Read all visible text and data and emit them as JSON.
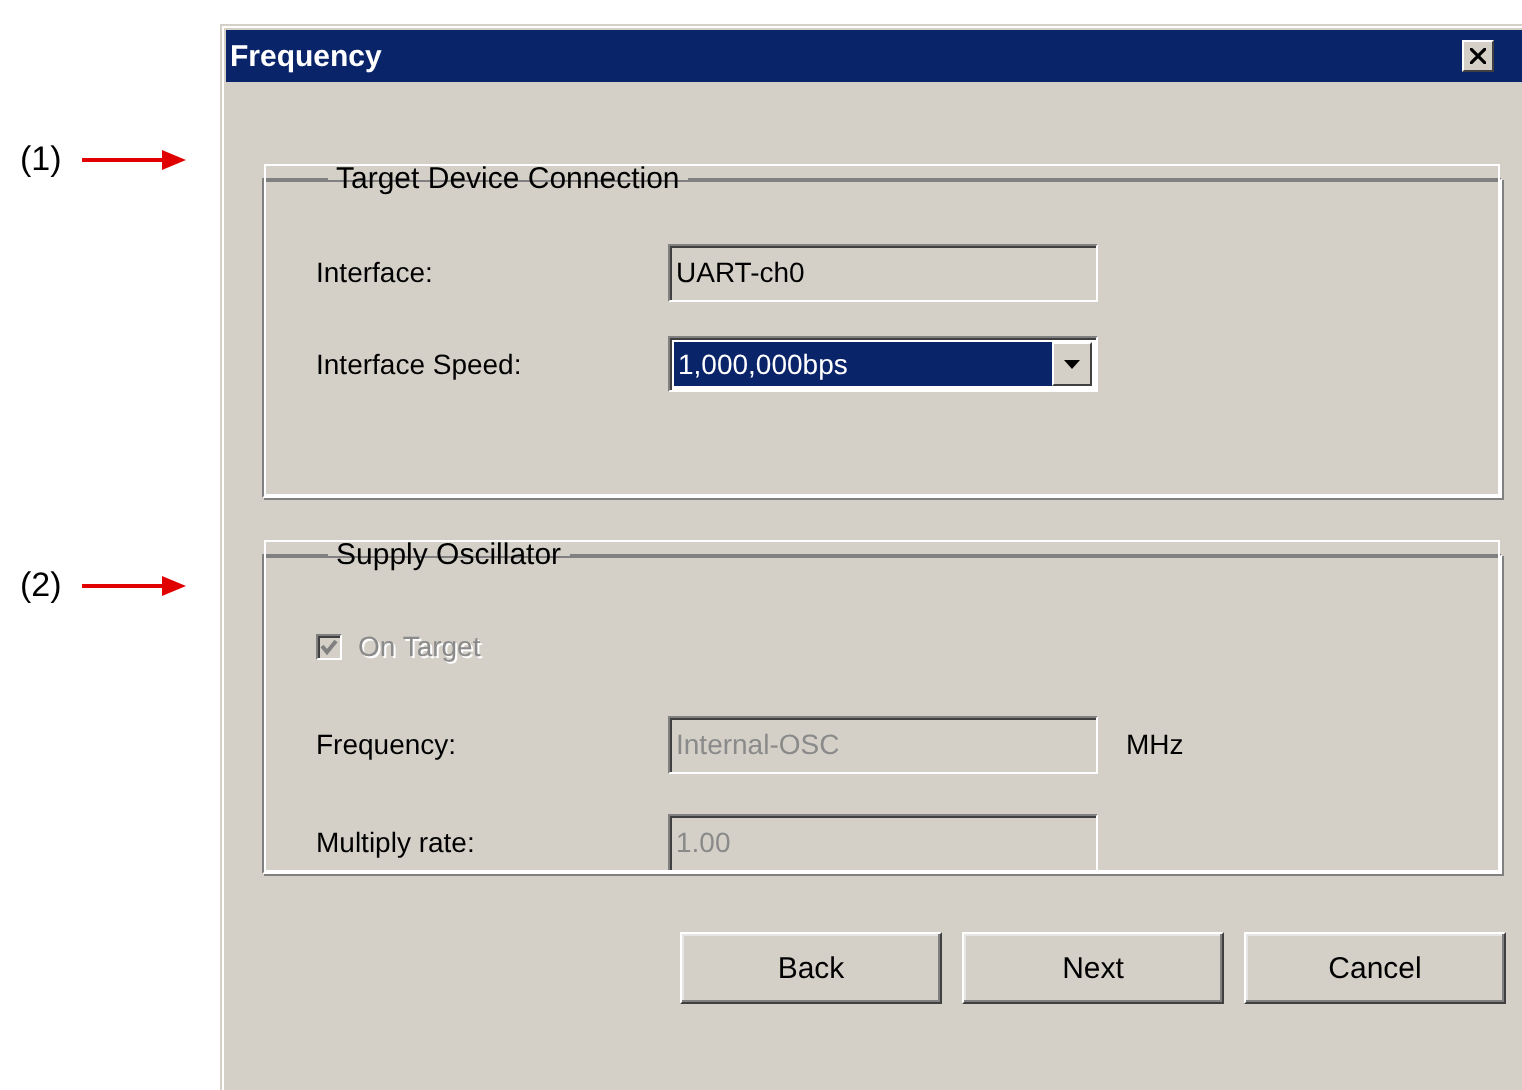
{
  "annotations": [
    {
      "label": "(1)"
    },
    {
      "label": "(2)"
    }
  ],
  "window": {
    "title": "Frequency"
  },
  "groups": [
    {
      "title": "Target Device Connection",
      "rows": [
        {
          "kind": "text",
          "label": "Interface:",
          "value": "UART-ch0",
          "disabled": false
        },
        {
          "kind": "dropdown",
          "label": "Interface Speed:",
          "value": "1,000,000bps",
          "selected": true
        }
      ]
    },
    {
      "title": "Supply Oscillator",
      "rows": [
        {
          "kind": "checkbox",
          "label": "On Target",
          "checked": true,
          "disabled": true
        },
        {
          "kind": "text",
          "label": "Frequency:",
          "value": "Internal-OSC",
          "unit": "MHz",
          "disabled": true
        },
        {
          "kind": "text",
          "label": "Multiply rate:",
          "value": "1.00",
          "disabled": true
        }
      ]
    }
  ],
  "buttons": [
    {
      "label": "Back"
    },
    {
      "label": "Next"
    },
    {
      "label": "Cancel"
    }
  ]
}
